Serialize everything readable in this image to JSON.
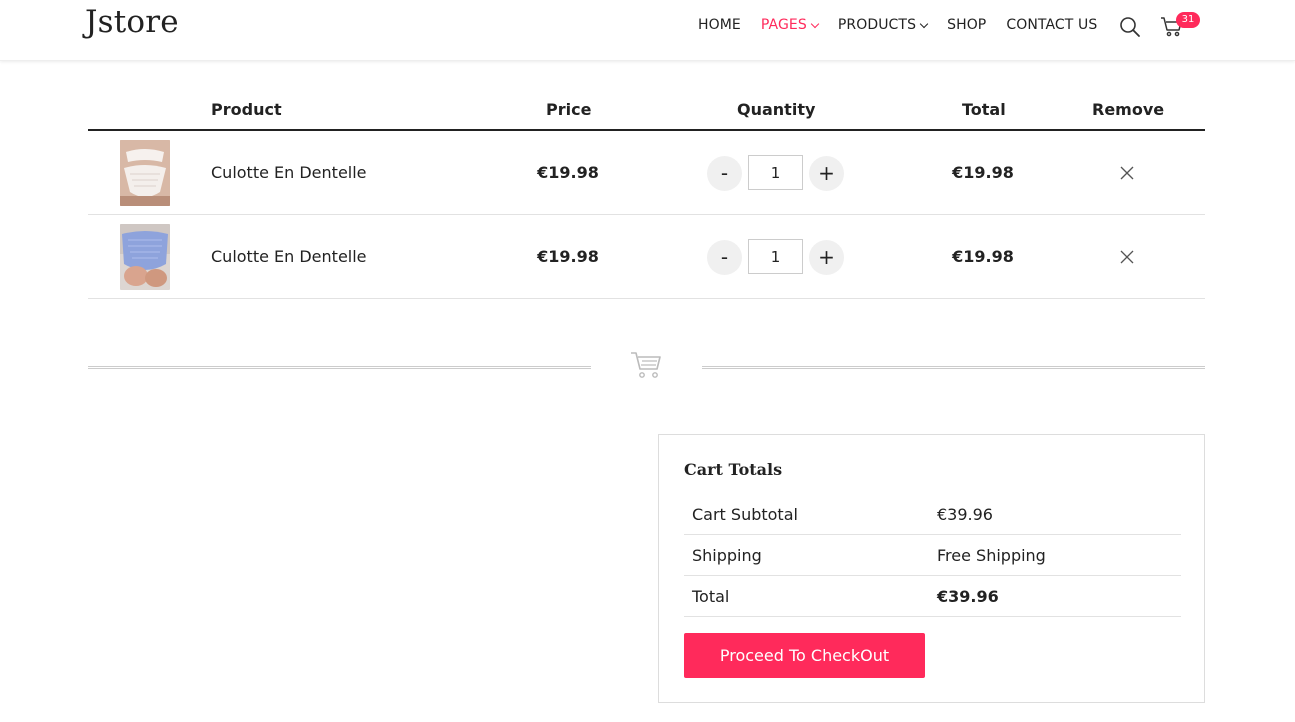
{
  "header": {
    "logo": "Jstore",
    "nav": [
      {
        "label": "HOME",
        "active": false,
        "dropdown": false
      },
      {
        "label": "PAGES",
        "active": true,
        "dropdown": true
      },
      {
        "label": "PRODUCTS",
        "active": false,
        "dropdown": true
      },
      {
        "label": "SHOP",
        "active": false,
        "dropdown": false
      },
      {
        "label": "CONTACT US",
        "active": false,
        "dropdown": false
      }
    ],
    "cart_count": "31",
    "icons": [
      "search-icon",
      "cart-icon"
    ]
  },
  "cart_table": {
    "headers": {
      "product": "Product",
      "price": "Price",
      "quantity": "Quantity",
      "total": "Total",
      "remove": "Remove"
    },
    "items": [
      {
        "name": "Culotte En Dentelle",
        "price": "€19.98",
        "qty_minus": "-",
        "quantity": "1",
        "qty_plus": "+",
        "total": "€19.98",
        "thumb_color": "#e9dcd6"
      },
      {
        "name": "Culotte En Dentelle",
        "price": "€19.98",
        "qty_minus": "-",
        "quantity": "1",
        "qty_plus": "+",
        "total": "€19.98",
        "thumb_color": "#8ea3dc"
      }
    ]
  },
  "cart_totals": {
    "title": "Cart Totals",
    "rows": [
      {
        "label": "Cart Subtotal",
        "value": "€39.96"
      },
      {
        "label": "Shipping",
        "value": "Free Shipping"
      },
      {
        "label": "Total",
        "value": "€39.96"
      }
    ],
    "checkout_label": "Proceed To CheckOut"
  },
  "colors": {
    "accent": "#ff2a5b",
    "text": "#222222",
    "border": "#e2e2e2"
  }
}
